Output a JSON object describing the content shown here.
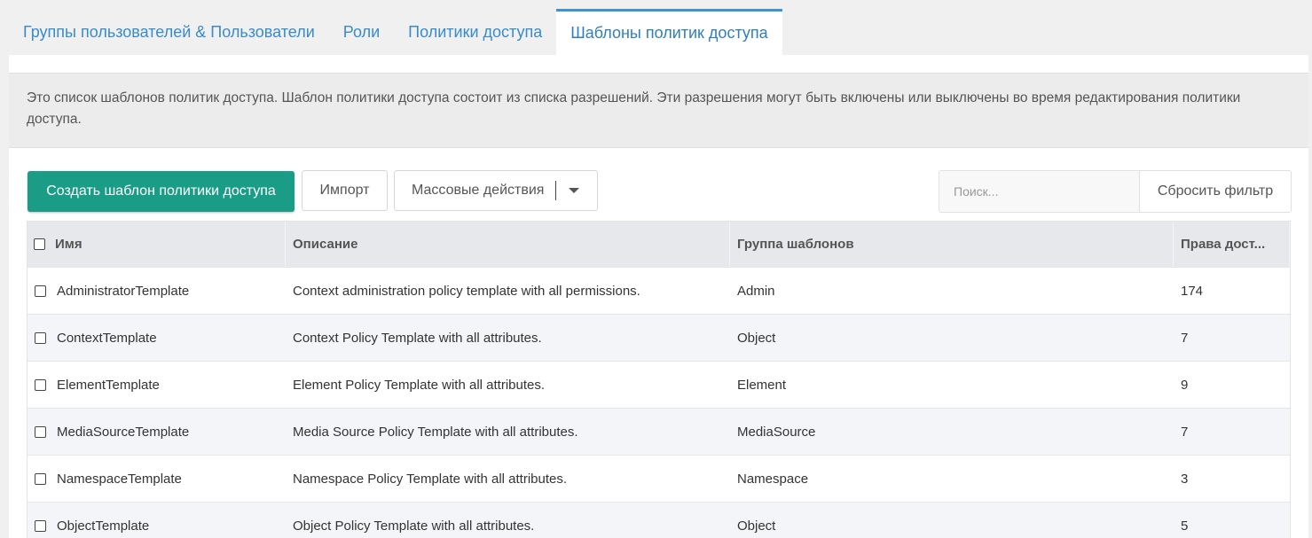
{
  "tabs": [
    {
      "label": "Группы пользователей & Пользователи"
    },
    {
      "label": "Роли"
    },
    {
      "label": "Политики доступа"
    },
    {
      "label": "Шаблоны политик доступа"
    }
  ],
  "description": "Это список шаблонов политик доступа. Шаблон политики доступа состоит из списка разрешений. Эти разрешения могут быть включены или выключены во время редактирования политики доступа.",
  "toolbar": {
    "create_label": "Создать шаблон политики доступа",
    "import_label": "Импорт",
    "mass_label": "Массовые действия",
    "search_placeholder": "Поиск...",
    "reset_label": "Сбросить фильтр"
  },
  "table": {
    "columns": [
      "Имя",
      "Описание",
      "Группа шаблонов",
      "Права дост..."
    ],
    "rows": [
      {
        "name": "AdministratorTemplate",
        "description": "Context administration policy template with all permissions.",
        "group": "Admin",
        "permissions": "174"
      },
      {
        "name": "ContextTemplate",
        "description": "Context Policy Template with all attributes.",
        "group": "Object",
        "permissions": "7"
      },
      {
        "name": "ElementTemplate",
        "description": "Element Policy Template with all attributes.",
        "group": "Element",
        "permissions": "9"
      },
      {
        "name": "MediaSourceTemplate",
        "description": "Media Source Policy Template with all attributes.",
        "group": "MediaSource",
        "permissions": "7"
      },
      {
        "name": "NamespaceTemplate",
        "description": "Namespace Policy Template with all attributes.",
        "group": "Namespace",
        "permissions": "3"
      },
      {
        "name": "ObjectTemplate",
        "description": "Object Policy Template with all attributes.",
        "group": "Object",
        "permissions": "5"
      }
    ]
  },
  "colors": {
    "accent": "#1a9c87",
    "tab_link": "#3b8bc6",
    "active_tab_border": "#3b94d4"
  }
}
